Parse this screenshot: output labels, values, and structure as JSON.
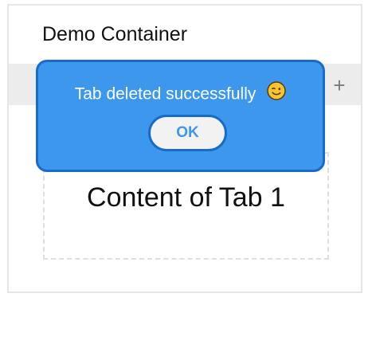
{
  "container": {
    "title": "Demo Container"
  },
  "tabs": {
    "add_button_label": "+"
  },
  "content": {
    "text": "Content of Tab 1"
  },
  "toast": {
    "message": "Tab deleted successfully",
    "emoji_icon": "winking-face-icon",
    "ok_label": "OK"
  },
  "colors": {
    "toast_bg": "#3d97ed",
    "toast_border": "#176bc9",
    "ok_text": "#3d97ed",
    "tab_bar_bg": "#ececec"
  }
}
